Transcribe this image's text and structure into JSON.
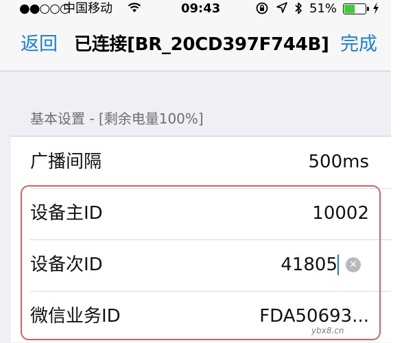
{
  "status_bar": {
    "signal": "●●○○○",
    "carrier": "中国移动",
    "wifi_icon": "wifi-icon",
    "time": "09:43",
    "lock_icon": "orientation-lock-icon",
    "location_icon": "location-arrow-icon",
    "bluetooth_icon": "bluetooth-icon",
    "battery_text": "51%",
    "battery_level": 0.51,
    "battery_color": "#3ecc3a",
    "charging_icon": "charging-bolt-icon"
  },
  "nav": {
    "back_label": "返回",
    "title": "已连接[BR_20CD397F744B]",
    "done_label": "完成",
    "accent_color": "#1a7fe3"
  },
  "section": {
    "header": "基本设置  -  [剩余电量100%]"
  },
  "rows": [
    {
      "label": "广播间隔",
      "value": "500ms"
    },
    {
      "label": "设备主ID",
      "value": "10002"
    },
    {
      "label": "设备次ID",
      "value": "41805"
    },
    {
      "label": "微信业务ID",
      "value": "FDA50693..."
    }
  ],
  "highlight_color": "#d96060",
  "watermark": "ybx8.cn"
}
